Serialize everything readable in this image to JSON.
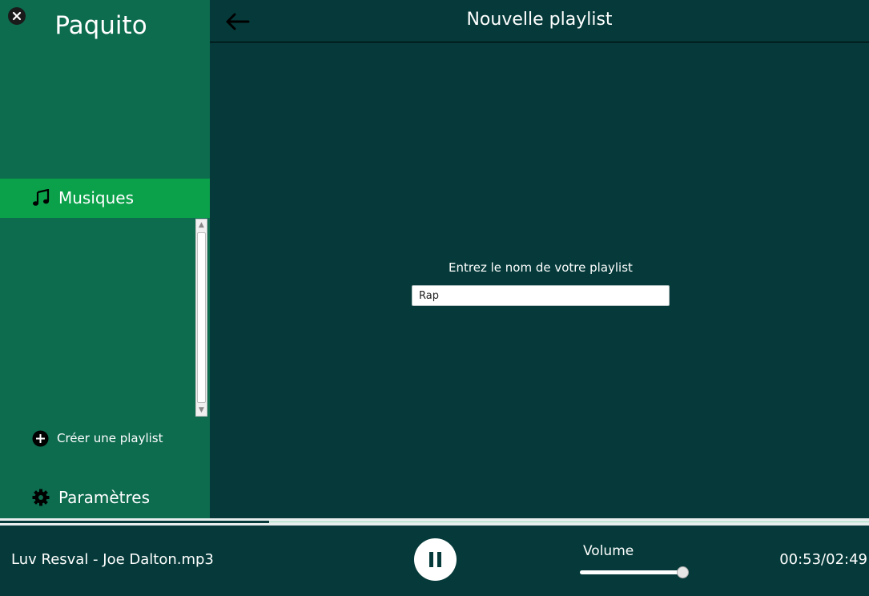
{
  "app": {
    "title": "Paquito"
  },
  "sidebar": {
    "nav_active": {
      "label": "Musiques",
      "icon": "music-note-icon"
    },
    "create_playlist": {
      "label": "Créer une playlist",
      "icon": "plus-circle-icon"
    },
    "settings": {
      "label": "Paramètres",
      "icon": "gear-icon"
    }
  },
  "header": {
    "title": "Nouvelle playlist",
    "back_icon": "arrow-left-icon"
  },
  "form": {
    "prompt": "Entrez le nom de votre playlist",
    "name_value": "Rap"
  },
  "player": {
    "track": "Luv Resval - Joe Dalton.mp3",
    "state_icon": "pause-icon",
    "volume_label": "Volume",
    "volume_level": 0.97,
    "time": "00:53/02:49",
    "progress": 0.31
  },
  "colors": {
    "sidebar_bg": "#0d6b4e",
    "active_nav_bg": "#0ba14a",
    "main_bg": "#063a3a"
  }
}
